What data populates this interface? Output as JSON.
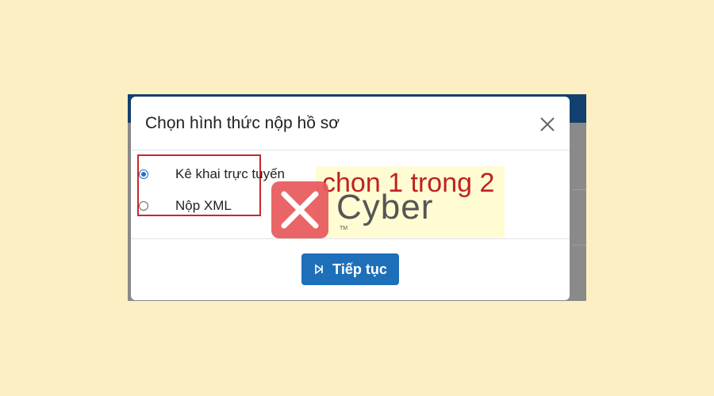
{
  "modal": {
    "title": "Chọn hình thức nộp hồ sơ",
    "options": [
      {
        "label": "Kê khai trực tuyến",
        "selected": true
      },
      {
        "label": "Nộp XML",
        "selected": false
      }
    ],
    "continue_label": "Tiếp tục",
    "primary_color": "#1d6fba"
  },
  "annotation": {
    "text": "chon 1 trong 2",
    "color": "#c0221f"
  },
  "watermark": {
    "brand": "Cyber",
    "tm": "TM"
  },
  "icons": {
    "close": "close-icon",
    "continue": "skip-forward-icon"
  }
}
